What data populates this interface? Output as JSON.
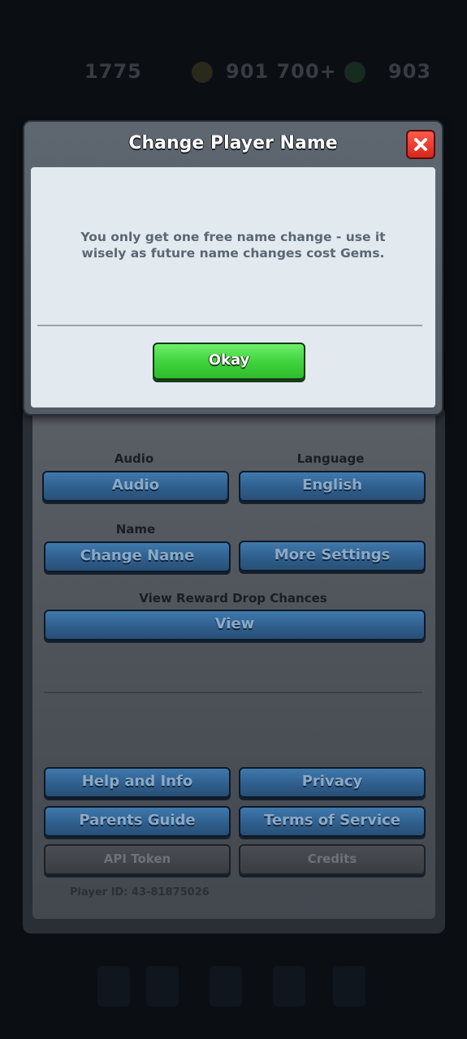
{
  "hud": {
    "trophies": "1775",
    "gold": "901 700+",
    "gems": "903"
  },
  "dialog": {
    "title": "Change Player Name",
    "message": "You only get one free name change - use it wisely as future name changes cost Gems.",
    "okay_label": "Okay",
    "close_icon": "close-x-icon"
  },
  "settings": {
    "audio_heading": "Audio",
    "audio_button": "Audio",
    "language_heading": "Language",
    "language_button": "English",
    "name_heading": "Name",
    "change_name_button": "Change Name",
    "more_settings_button": "More Settings",
    "reward_heading": "View Reward Drop Chances",
    "view_button": "View",
    "help_button": "Help and Info",
    "privacy_button": "Privacy",
    "parents_button": "Parents Guide",
    "terms_button": "Terms of Service",
    "api_button": "API Token",
    "credits_button": "Credits",
    "player_id": "Player ID: 43-81875026"
  },
  "colors": {
    "okay_green": "#40d43e",
    "close_red": "#e3322a",
    "settings_blue": "#2f5f8d"
  }
}
